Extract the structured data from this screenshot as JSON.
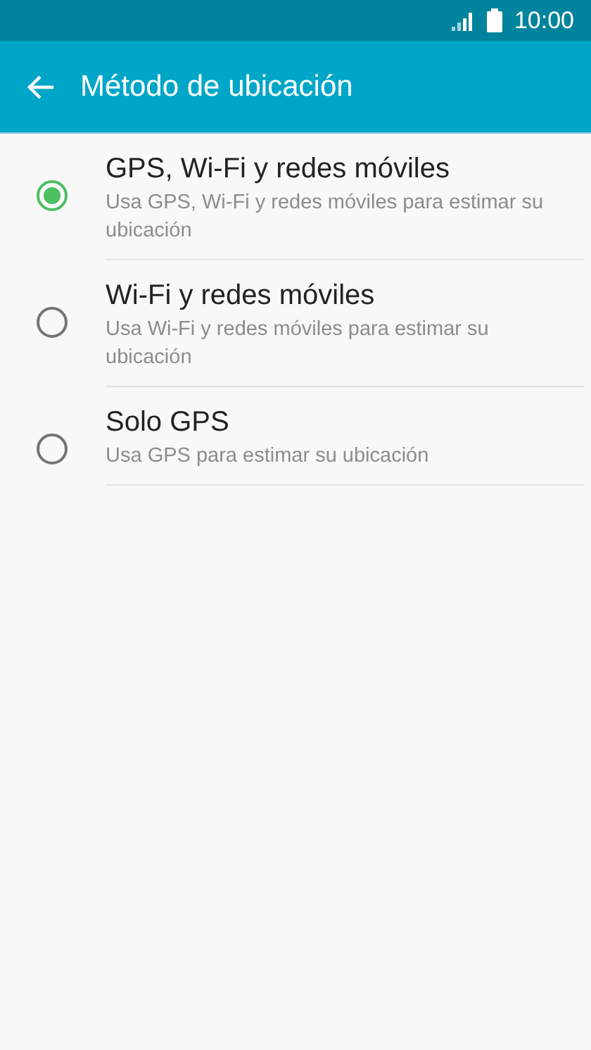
{
  "status_bar": {
    "time": "10:00"
  },
  "app_bar": {
    "title": "Método de ubicación"
  },
  "options": [
    {
      "title": "GPS, Wi-Fi y redes móviles",
      "subtitle": "Usa GPS, Wi-Fi y redes móviles para estimar su ubicación",
      "selected": true
    },
    {
      "title": "Wi-Fi y redes móviles",
      "subtitle": "Usa Wi-Fi y redes móviles para estimar su ubicación",
      "selected": false
    },
    {
      "title": "Solo GPS",
      "subtitle": "Usa GPS para estimar su ubicación",
      "selected": false
    }
  ]
}
